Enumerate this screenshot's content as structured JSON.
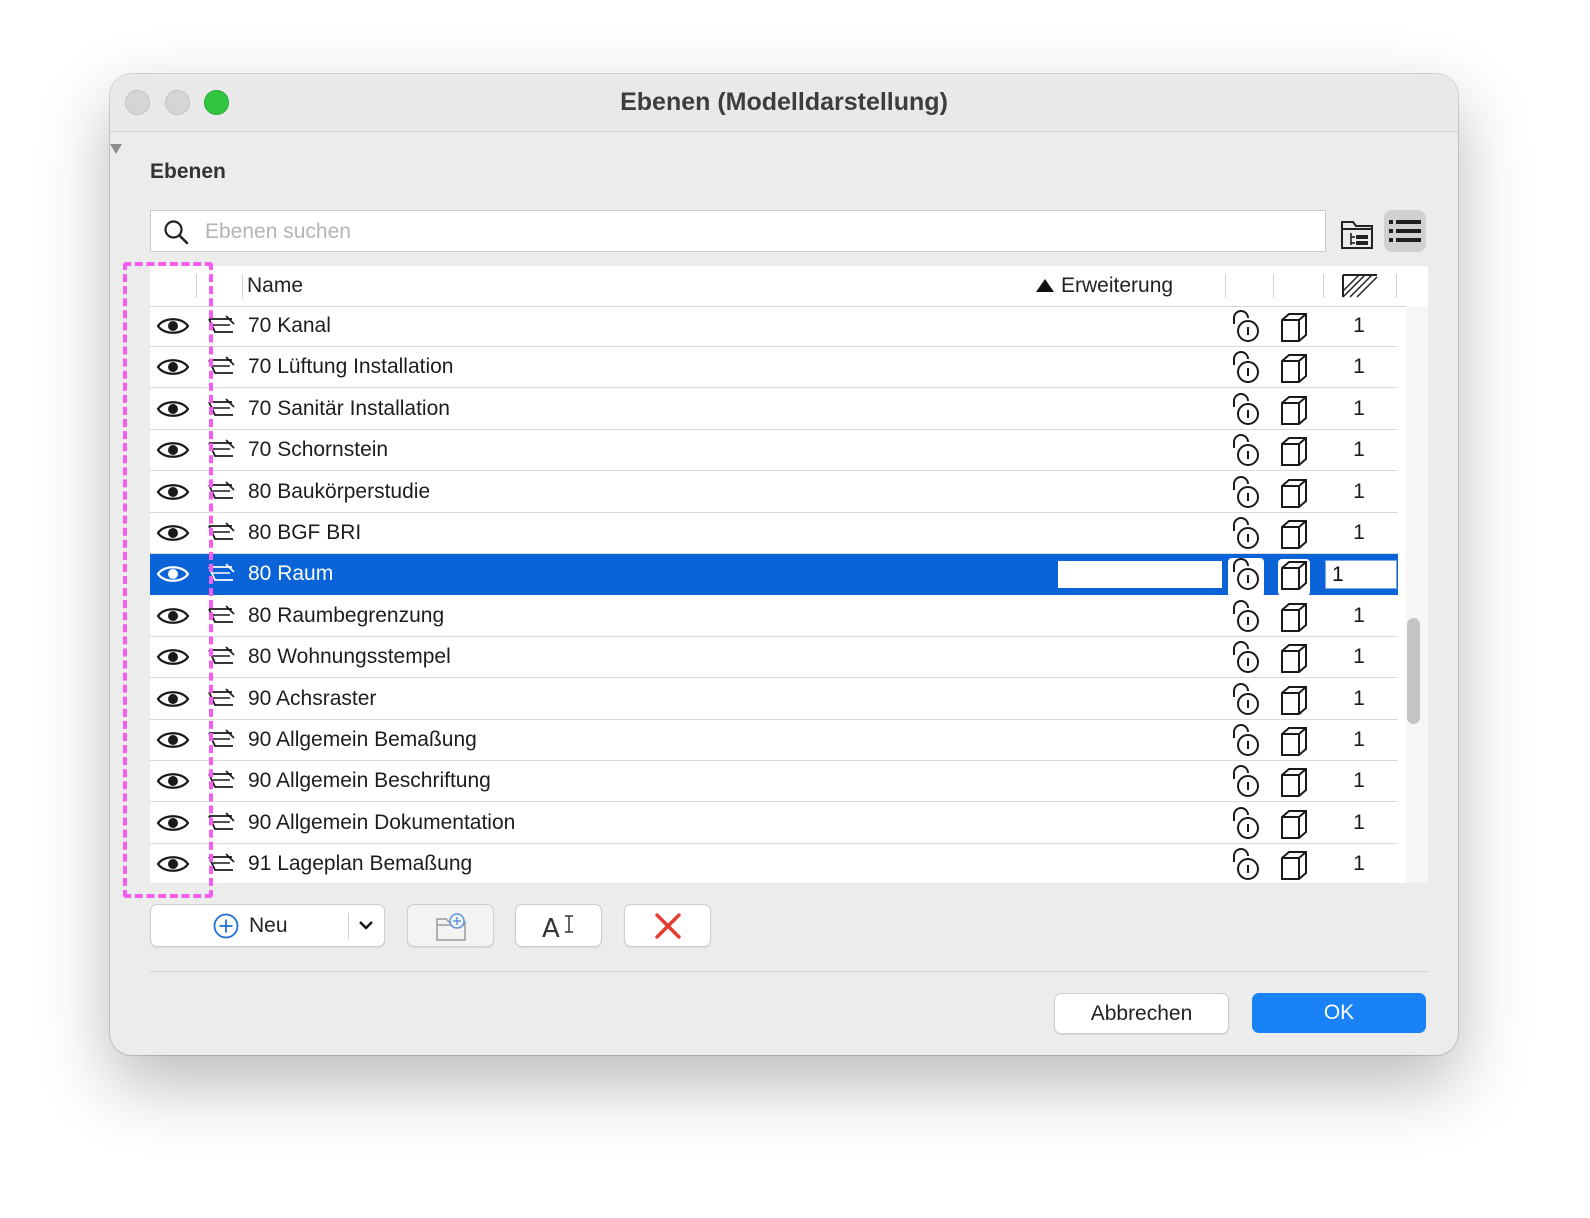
{
  "window": {
    "title": "Ebenen (Modelldarstellung)"
  },
  "section": {
    "label": "Ebenen"
  },
  "search": {
    "placeholder": "Ebenen suchen",
    "value": ""
  },
  "table": {
    "headers": {
      "name": "Name",
      "extension": "Erweiterung"
    },
    "sort": "ascending",
    "rows": [
      {
        "name": "70 Kanal",
        "number": "1",
        "visible": true,
        "selected": false
      },
      {
        "name": "70 Lüftung Installation",
        "number": "1",
        "visible": true,
        "selected": false
      },
      {
        "name": "70 Sanitär Installation",
        "number": "1",
        "visible": true,
        "selected": false
      },
      {
        "name": "70 Schornstein",
        "number": "1",
        "visible": true,
        "selected": false
      },
      {
        "name": "80 Baukörperstudie",
        "number": "1",
        "visible": true,
        "selected": false
      },
      {
        "name": "80 BGF BRI",
        "number": "1",
        "visible": true,
        "selected": false
      },
      {
        "name": "80 Raum",
        "number": "1",
        "visible": true,
        "selected": true,
        "extension_value": ""
      },
      {
        "name": "80 Raumbegrenzung",
        "number": "1",
        "visible": true,
        "selected": false
      },
      {
        "name": "80 Wohnungsstempel",
        "number": "1",
        "visible": true,
        "selected": false
      },
      {
        "name": "90 Achsraster",
        "number": "1",
        "visible": true,
        "selected": false
      },
      {
        "name": "90 Allgemein Bemaßung",
        "number": "1",
        "visible": true,
        "selected": false
      },
      {
        "name": "90 Allgemein Beschriftung",
        "number": "1",
        "visible": true,
        "selected": false
      },
      {
        "name": "90 Allgemein Dokumentation",
        "number": "1",
        "visible": true,
        "selected": false
      },
      {
        "name": "91 Lageplan Bemaßung",
        "number": "1",
        "visible": true,
        "selected": false
      }
    ]
  },
  "toolbar": {
    "new_label": "Neu"
  },
  "footer": {
    "cancel_label": "Abbrechen",
    "ok_label": "OK"
  },
  "icons": {
    "visibility": "eye-icon",
    "layer_type": "layer-icon",
    "lock": "lock-open-icon",
    "wireframe": "wireframe-icon",
    "search": "search-icon",
    "tree_view": "folder-tree-icon",
    "list_view": "list-icon",
    "add": "plus-circle-icon",
    "new_folder": "folder-plus-icon",
    "rename": "rename-icon",
    "delete": "delete-x-icon"
  },
  "colors": {
    "selection": "#0a64d8",
    "accent": "#1a82f7",
    "annotation_highlight": "#f45df0",
    "delete": "#e8392e"
  }
}
